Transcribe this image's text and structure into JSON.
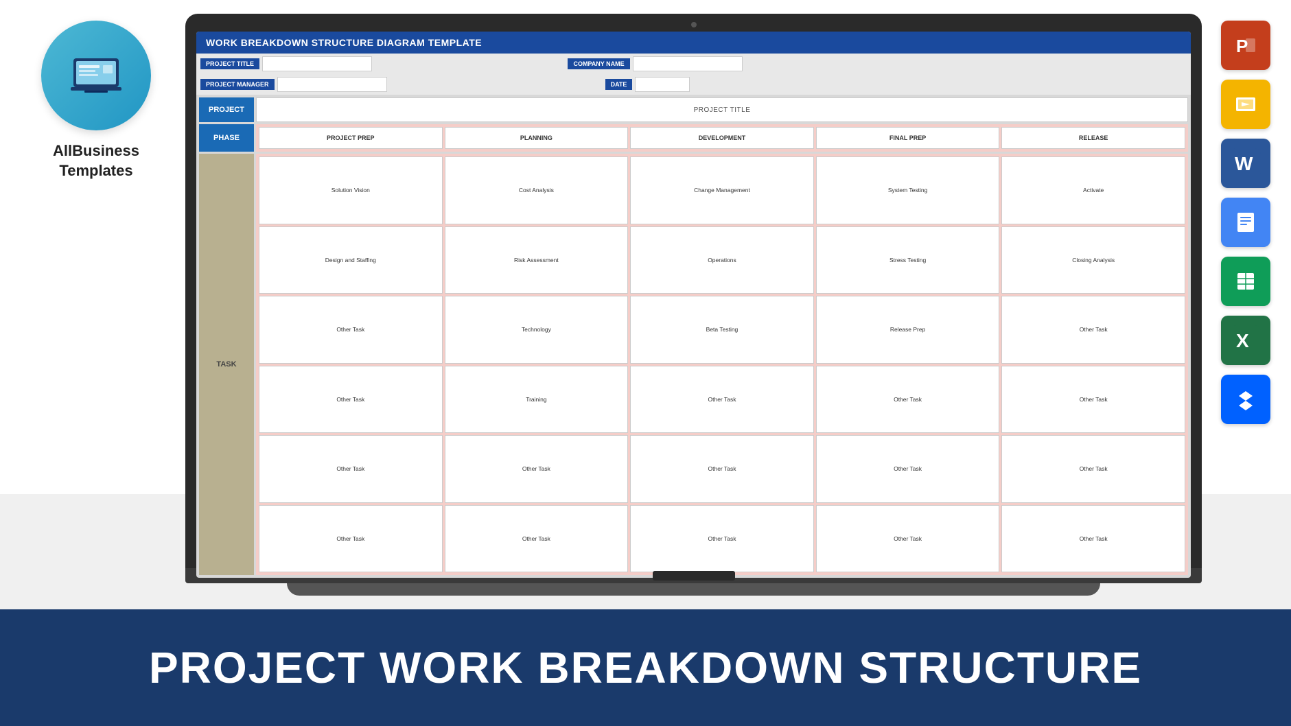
{
  "brand": {
    "name": "AllBusiness\nTemplates"
  },
  "bottom_banner": {
    "text": "PROJECT WORK BREAKDOWN STRUCTURE"
  },
  "wbs": {
    "header": "WORK BREAKDOWN STRUCTURE DIAGRAM TEMPLATE",
    "info_rows": [
      {
        "label": "PROJECT TITLE",
        "value": ""
      },
      {
        "label": "COMPANY NAME",
        "value": ""
      },
      {
        "label": "PROJECT MANAGER",
        "value": ""
      },
      {
        "label": "DATE",
        "value": ""
      }
    ],
    "project_label": "PROJECT",
    "project_title": "PROJECT TITLE",
    "phase_label": "PHASE",
    "phases": [
      "PROJECT PREP",
      "PLANNING",
      "DEVELOPMENT",
      "FINAL PREP",
      "RELEASE"
    ],
    "task_label": "TASK",
    "task_columns": [
      [
        "Solution Vision",
        "Design and Staffing",
        "Other Task",
        "Other Task",
        "Other Task",
        "Other Task"
      ],
      [
        "Cost Analysis",
        "Risk Assessment",
        "Technology",
        "Training",
        "Other Task",
        "Other Task"
      ],
      [
        "Change Management",
        "Operations",
        "Beta Testing",
        "Other Task",
        "Other Task",
        "Other Task"
      ],
      [
        "System Testing",
        "Stress Testing",
        "Release Prep",
        "Other Task",
        "Other Task",
        "Other Task"
      ],
      [
        "Activate",
        "Closing Analysis",
        "Other Task",
        "Other Task",
        "Other Task",
        "Other Task"
      ]
    ]
  },
  "app_icons": [
    {
      "name": "PowerPoint",
      "letter": "P",
      "class": "icon-ppt"
    },
    {
      "name": "Google Slides",
      "letter": "▶",
      "class": "icon-slides"
    },
    {
      "name": "Word",
      "letter": "W",
      "class": "icon-word"
    },
    {
      "name": "Google Docs",
      "letter": "≡",
      "class": "icon-docs"
    },
    {
      "name": "Google Sheets",
      "letter": "⊞",
      "class": "icon-sheets-green"
    },
    {
      "name": "Excel",
      "letter": "X",
      "class": "icon-excel"
    },
    {
      "name": "Dropbox",
      "letter": "❖",
      "class": "icon-dropbox"
    }
  ]
}
